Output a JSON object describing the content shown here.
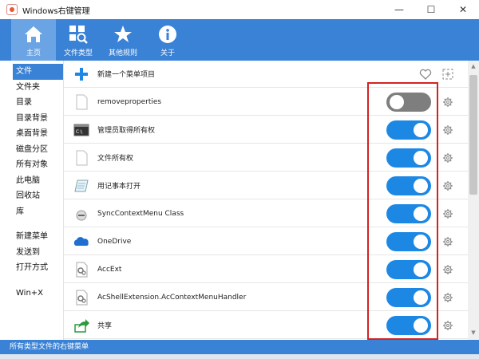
{
  "window": {
    "title": "Windows右键管理",
    "minimize": "—",
    "maximize": "☐",
    "close": "✕"
  },
  "toolbar": {
    "items": [
      {
        "label": "主页",
        "icon": "home-icon",
        "active": true
      },
      {
        "label": "文件类型",
        "icon": "search-file-icon",
        "active": false
      },
      {
        "label": "其他规则",
        "icon": "star-icon",
        "active": false
      },
      {
        "label": "关于",
        "icon": "info-icon",
        "active": false
      }
    ]
  },
  "sidebar": {
    "group1": [
      "文件",
      "文件夹",
      "目录",
      "目录背景",
      "桌面背景",
      "磁盘分区",
      "所有对象",
      "此电脑",
      "回收站",
      "库"
    ],
    "group2": [
      "新建菜单",
      "发送到",
      "打开方式"
    ],
    "group3": [
      "Win+X"
    ],
    "active": "文件"
  },
  "content": {
    "new_item": "新建一个菜单项目",
    "rows": [
      {
        "label": "removeproperties",
        "icon": "blank-file-icon",
        "state": "off"
      },
      {
        "label": "管理员取得所有权",
        "icon": "cmd-icon",
        "state": "on"
      },
      {
        "label": "文件所有权",
        "icon": "blank-file-icon",
        "state": "on"
      },
      {
        "label": "用记事本打开",
        "icon": "notepad-icon",
        "state": "on"
      },
      {
        "label": "SyncContextMenu Class",
        "icon": "sync-icon",
        "state": "on"
      },
      {
        "label": "OneDrive",
        "icon": "onedrive-icon",
        "state": "on"
      },
      {
        "label": "AccExt",
        "icon": "dll-icon",
        "state": "on"
      },
      {
        "label": "AcShellExtension.AcContextMenuHandler",
        "icon": "dll-icon",
        "state": "on"
      },
      {
        "label": "共享",
        "icon": "share-icon",
        "state": "on"
      }
    ]
  },
  "status": {
    "text": "所有类型文件的右键菜单"
  },
  "colors": {
    "accent": "#3a82d6",
    "toggle_on": "#1d88e4",
    "toggle_off": "#7e7e7e",
    "highlight": "#d42222"
  }
}
